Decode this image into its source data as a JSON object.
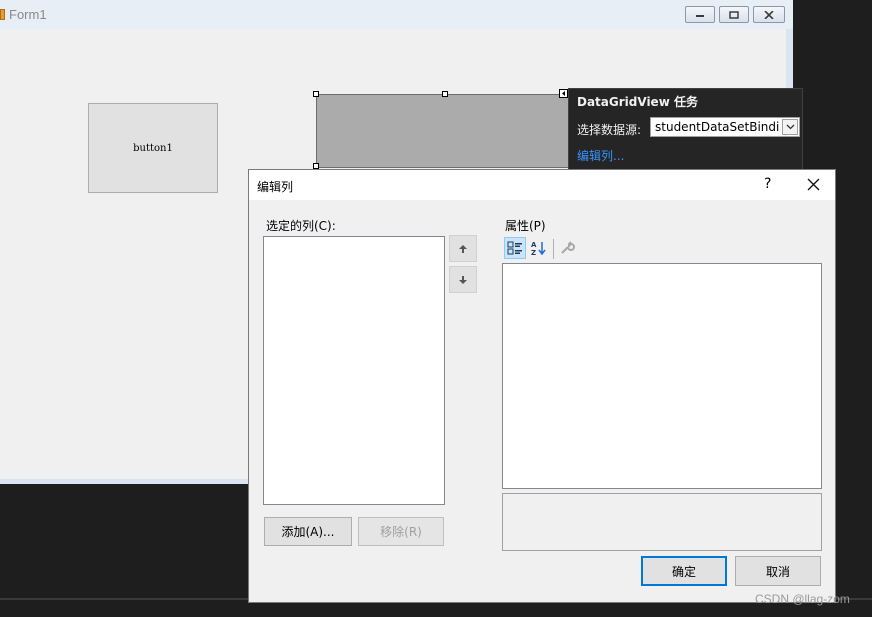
{
  "form": {
    "title": "Form1",
    "button1_label": "button1"
  },
  "smart_tag": {
    "title": "DataGridView 任务",
    "datasource_label": "选择数据源:",
    "datasource_value": "studentDataSetBindi",
    "edit_columns_link": "编辑列..."
  },
  "dialog": {
    "title": "编辑列",
    "help": "?",
    "selected_columns_label": "选定的列(C):",
    "properties_label": "属性(P)",
    "add_button": "添加(A)...",
    "remove_button": "移除(R)",
    "ok_button": "确定",
    "cancel_button": "取消",
    "selected_columns": [],
    "toolbar_icons": [
      "categorized-icon",
      "alphabetical-sort-icon",
      "property-pages-icon"
    ]
  },
  "watermark": "CSDN @llag-zom",
  "colors": {
    "accent": "#0078d7",
    "link": "#3794ff",
    "panel_bg": "#252526",
    "ide_bg": "#1e1e1e"
  }
}
